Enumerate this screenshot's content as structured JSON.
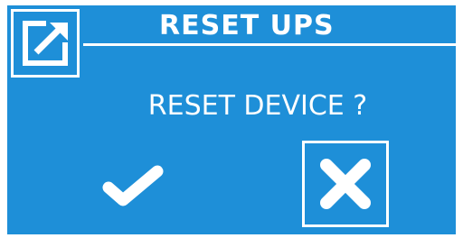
{
  "header": {
    "title": "RESET UPS",
    "icon": "external-link-icon"
  },
  "dialog": {
    "question": "RESET DEVICE ?"
  },
  "actions": {
    "confirm_icon": "checkmark-icon",
    "cancel_icon": "close-icon"
  },
  "colors": {
    "background": "#1e8fd8",
    "foreground": "#ffffff"
  }
}
